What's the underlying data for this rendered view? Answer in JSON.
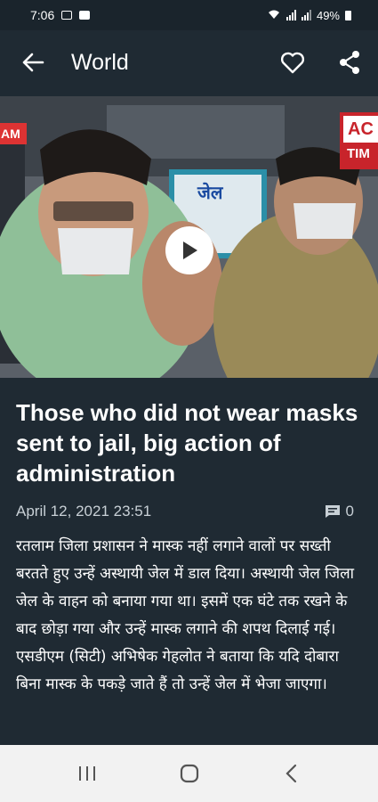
{
  "status_bar": {
    "time": "7:06",
    "battery": "49%",
    "network": "VoLTE"
  },
  "app_bar": {
    "title": "World",
    "back_icon": "arrow-left-icon",
    "favorite_icon": "heart-outline-icon",
    "share_icon": "share-icon"
  },
  "video": {
    "play_icon": "play-icon",
    "channel_logo_text": "AC",
    "channel_logo_subtext": "TIM",
    "corner_tag": "AM",
    "banner_text": "जेल"
  },
  "article": {
    "headline": "Those who did not wear masks sent to jail, big action of administration",
    "date": "April 12, 2021 23:51",
    "comment_count": "0",
    "body": "रतलाम जिला प्रशासन ने मास्क नहीं लगाने वालों पर सख्ती बरतते हुए उन्हें अस्थायी जेल में डाल दिया। अस्थायी जेल जिला जेल के वाहन को बनाया गया था। इसमें एक घंटे तक रखने के बाद छोड़ा गया और उन्हें मास्क लगाने की शपथ दिलाई गई। एसडीएम (सिटी) अभिषेक गेहलोत ने बताया कि यदि दोबारा बिना मास्क के पकड़े जाते हैं तो उन्हें जेल में भेजा जाएगा।"
  },
  "colors": {
    "background": "#1f2a33",
    "nav_bar": "#f2f2f2"
  }
}
